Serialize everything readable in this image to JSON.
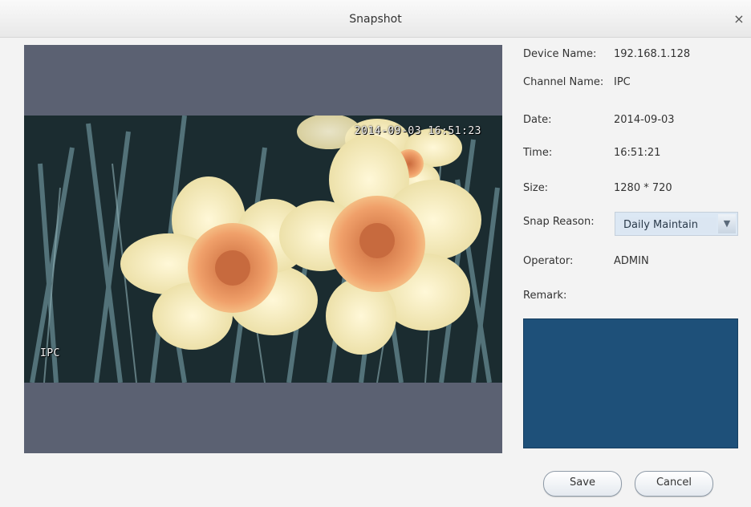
{
  "window": {
    "title": "Snapshot",
    "close_glyph": "×"
  },
  "preview": {
    "timestamp_overlay": "2014-09-03 16:51:23",
    "channel_overlay": "IPC"
  },
  "info": {
    "device_name_label": "Device Name:",
    "device_name_value": "192.168.1.128",
    "channel_name_label": "Channel Name:",
    "channel_name_value": "IPC",
    "date_label": "Date:",
    "date_value": "2014-09-03",
    "time_label": "Time:",
    "time_value": "16:51:21",
    "size_label": "Size:",
    "size_value": "1280 * 720",
    "snap_reason_label": "Snap Reason:",
    "snap_reason_value": "Daily Maintain",
    "operator_label": "Operator:",
    "operator_value": "ADMIN",
    "remark_label": "Remark:",
    "remark_value": ""
  },
  "buttons": {
    "save": "Save",
    "cancel": "Cancel"
  },
  "colors": {
    "preview_bg": "#5b6172",
    "remark_bg": "#1e5079",
    "select_bg": "#dce8f4"
  },
  "icons": {
    "close": "close-icon",
    "dropdown": "chevron-down-icon"
  }
}
